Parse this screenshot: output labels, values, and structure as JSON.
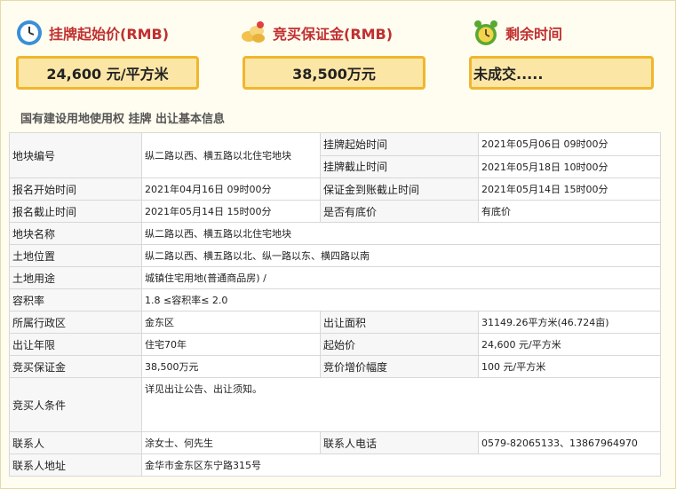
{
  "header": {
    "start_price_label": "挂牌起始价(RMB)",
    "deposit_label": "竞买保证金(RMB)",
    "remaining_label": "剩余时间",
    "start_price_value": "24,600 元/平方米",
    "deposit_value": "38,500万元",
    "remaining_value": "未成交....."
  },
  "section_title": "国有建设用地使用权 挂牌 出让基本信息",
  "table": {
    "plot_no_k": "地块编号",
    "plot_no_v": "纵二路以西、横五路以北住宅地块",
    "list_start_k": "挂牌起始时间",
    "list_start_v": "2021年05月06日 09时00分",
    "list_end_k": "挂牌截止时间",
    "list_end_v": "2021年05月18日 10时00分",
    "apply_start_k": "报名开始时间",
    "apply_start_v": "2021年04月16日 09时00分",
    "deposit_deadline_k": "保证金到账截止时间",
    "deposit_deadline_v": "2021年05月14日 15时00分",
    "apply_end_k": "报名截止时间",
    "apply_end_v": "2021年05月14日 15时00分",
    "reserve_k": "是否有底价",
    "reserve_v": "有底价",
    "plot_name_k": "地块名称",
    "plot_name_v": "纵二路以西、横五路以北住宅地块",
    "location_k": "土地位置",
    "location_v": "纵二路以西、横五路以北、纵一路以东、横四路以南",
    "use_k": "土地用途",
    "use_v": "城镇住宅用地(普通商品房) /",
    "far_k": "容积率",
    "far_v": "1.8 ≤容积率≤ 2.0",
    "district_k": "所属行政区",
    "district_v": "金东区",
    "area_k": "出让面积",
    "area_v": "31149.26平方米(46.724亩)",
    "term_k": "出让年限",
    "term_v": "住宅70年",
    "start_price_k": "起始价",
    "start_price_v": "24,600 元/平方米",
    "bid_deposit_k": "竞买保证金",
    "bid_deposit_v": "38,500万元",
    "increment_k": "竞价增价幅度",
    "increment_v": "100 元/平方米",
    "conditions_k": "竞买人条件",
    "conditions_v": "详见出让公告、出让须知。",
    "contact_k": "联系人",
    "contact_v": "涂女士、何先生",
    "phone_k": "联系人电话",
    "phone_v": "0579-82065133、13867964970",
    "address_k": "联系人地址",
    "address_v": "金华市金东区东宁路315号"
  }
}
